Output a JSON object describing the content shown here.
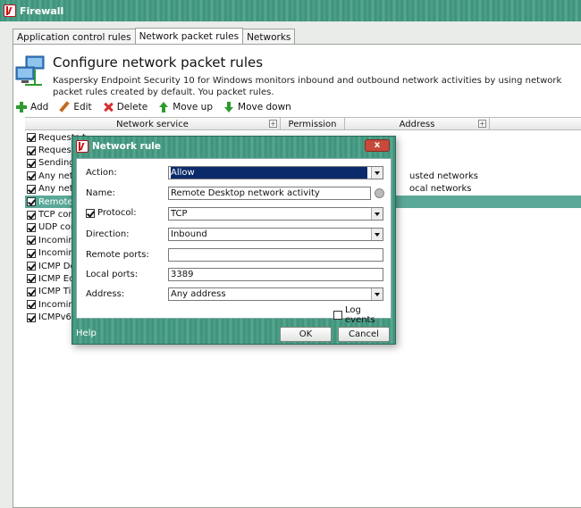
{
  "window": {
    "title": "Firewall"
  },
  "tabs": [
    {
      "label": "Application control rules"
    },
    {
      "label": "Network packet rules"
    },
    {
      "label": "Networks"
    }
  ],
  "header": {
    "title": "Configure network packet rules",
    "description": "Kaspersky Endpoint Security 10 for Windows monitors inbound and outbound network activities by using network packet rules created by default. You packet rules."
  },
  "toolbar": {
    "add": "Add",
    "edit": "Edit",
    "delete": "Delete",
    "move_up": "Move up",
    "move_down": "Move down"
  },
  "grid": {
    "columns": {
      "service": "Network service",
      "permission": "Permission",
      "address": "Address"
    },
    "rows": [
      {
        "name": "Requests t",
        "address": "",
        "checked": true
      },
      {
        "name": "Requests",
        "address": "",
        "checked": true
      },
      {
        "name": "Sending e",
        "address": "",
        "checked": true
      },
      {
        "name": "Any netw",
        "address": "usted networks",
        "checked": true
      },
      {
        "name": "Any netw",
        "address": "ocal networks",
        "checked": true
      },
      {
        "name": "Remote D",
        "address": "",
        "checked": true
      },
      {
        "name": "TCP conn",
        "address": "",
        "checked": true
      },
      {
        "name": "UDP conn",
        "address": "",
        "checked": true
      },
      {
        "name": "Incoming",
        "address": "",
        "checked": true
      },
      {
        "name": "Incoming",
        "address": "",
        "checked": true
      },
      {
        "name": "ICMP Des",
        "address": "",
        "checked": true
      },
      {
        "name": "ICMP Echo",
        "address": "",
        "checked": true
      },
      {
        "name": "ICMP Time",
        "address": "",
        "checked": true
      },
      {
        "name": "Incoming",
        "address": "",
        "checked": true
      },
      {
        "name": "ICMPv6 E",
        "address": "",
        "checked": true
      }
    ]
  },
  "dialog": {
    "title": "Network rule",
    "close": "x",
    "action_label": "Action:",
    "action_value": "Allow",
    "name_label": "Name:",
    "name_value": "Remote Desktop network activity",
    "protocol_label": "Protocol:",
    "protocol_value": "TCP",
    "direction_label": "Direction:",
    "direction_value": "Inbound",
    "remote_ports_label": "Remote ports:",
    "remote_ports_value": "",
    "local_ports_label": "Local ports:",
    "local_ports_value": "3389",
    "address_label": "Address:",
    "address_value": "Any address",
    "log_events": "Log events",
    "help": "Help",
    "ok": "OK",
    "cancel": "Cancel"
  }
}
